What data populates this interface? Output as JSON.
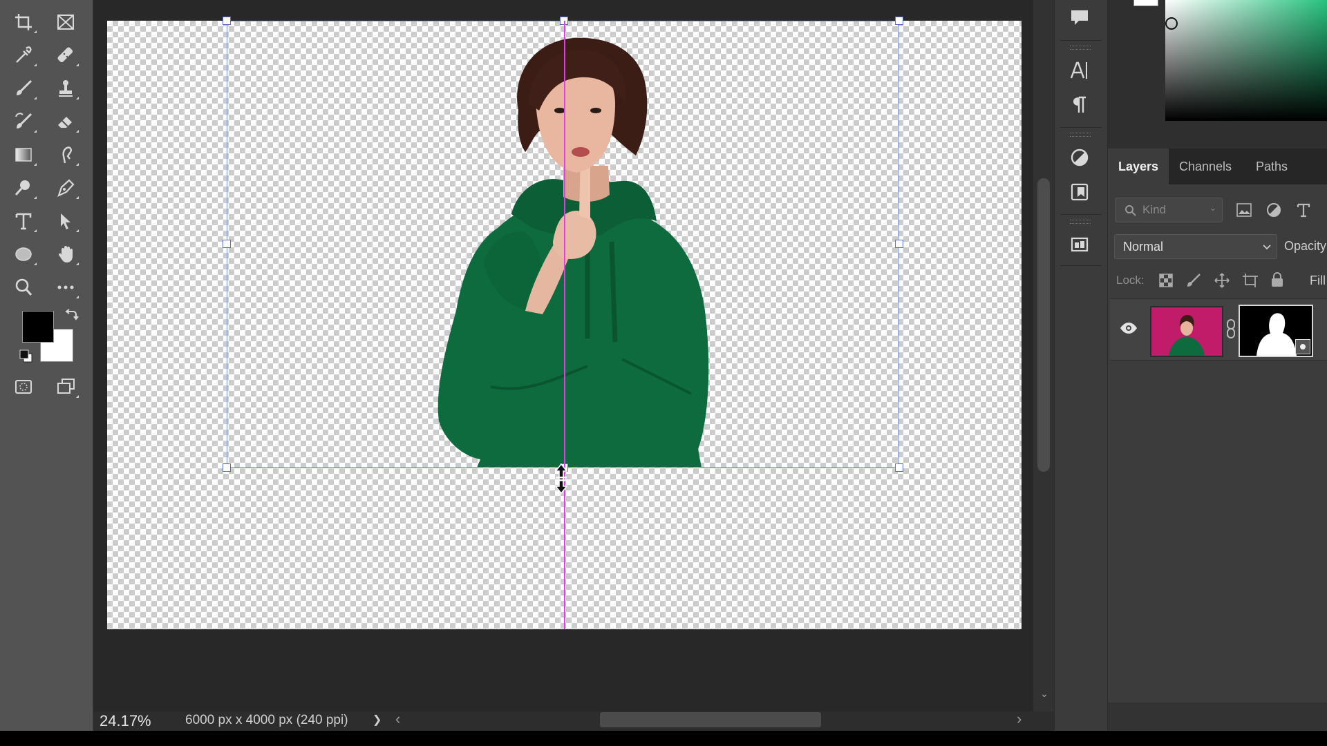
{
  "toolbar": {
    "tools": [
      {
        "name": "crop-tool",
        "icon": "crop-icon"
      },
      {
        "name": "frame-tool",
        "icon": "frame-icon"
      },
      {
        "name": "eyedropper-tool",
        "icon": "eyedropper-icon"
      },
      {
        "name": "spot-healing-tool",
        "icon": "healing-brush-icon"
      },
      {
        "name": "brush-tool",
        "icon": "brush-icon"
      },
      {
        "name": "clone-stamp-tool",
        "icon": "stamp-icon"
      },
      {
        "name": "history-brush-tool",
        "icon": "history-brush-icon"
      },
      {
        "name": "eraser-tool",
        "icon": "eraser-icon"
      },
      {
        "name": "gradient-tool",
        "icon": "gradient-icon"
      },
      {
        "name": "smudge-tool",
        "icon": "smudge-icon"
      },
      {
        "name": "dodge-tool",
        "icon": "dodge-icon"
      },
      {
        "name": "pen-tool",
        "icon": "pen-icon"
      },
      {
        "name": "type-tool",
        "icon": "type-icon"
      },
      {
        "name": "path-selection-tool",
        "icon": "arrow-icon"
      },
      {
        "name": "ellipse-tool",
        "icon": "ellipse-icon"
      },
      {
        "name": "hand-tool",
        "icon": "hand-icon"
      },
      {
        "name": "zoom-tool",
        "icon": "magnifier-icon"
      },
      {
        "name": "more-tools",
        "icon": "ellipsis-icon"
      }
    ],
    "foreground_color": "#000000",
    "background_color": "#ffffff"
  },
  "canvas": {
    "background": "transparent-checkerboard",
    "guide_color": "#e040e0",
    "bounding_box_color": "#7c8fd6",
    "subject": "woman in green hoodie with finger on lips",
    "cursor": "vertical-resize-cursor"
  },
  "status": {
    "zoom": "24.17%",
    "doc_info": "6000 px x 4000 px (240 ppi)",
    "expand_arrow": "❯",
    "scroll_left": "‹",
    "scroll_right": "›"
  },
  "side_icons": [
    "comment-icon",
    "character-icon",
    "paragraph-icon",
    "adjustments-icon",
    "libraries-icon",
    "artboard-icon"
  ],
  "color_picker": {
    "hue_color": "#26c27e"
  },
  "layers_panel": {
    "tabs": [
      "Layers",
      "Channels",
      "Paths"
    ],
    "active_tab": "Layers",
    "filter_placeholder": "Kind",
    "blend_mode": "Normal",
    "opacity_label": "Opacity",
    "lock_label": "Lock:",
    "fill_label": "Fill",
    "layer": {
      "visible": true,
      "thumbnail_bg": "#c01c6a",
      "has_mask": true
    }
  }
}
